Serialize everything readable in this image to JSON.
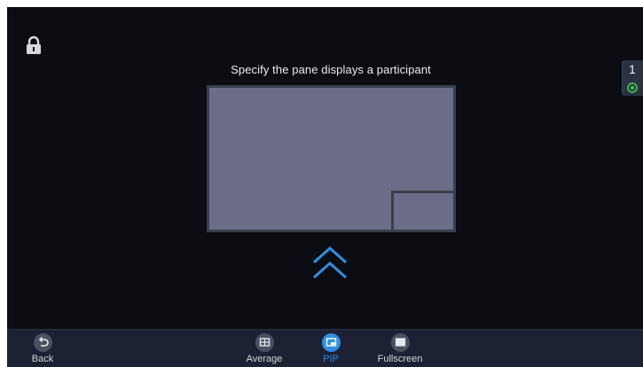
{
  "title": "Specify the pane displays a participant",
  "side_tab": {
    "number": "1"
  },
  "bottom_bar": {
    "back": "Back",
    "average": "Average",
    "pip": "PIP",
    "fullscreen": "Fullscreen",
    "active": "pip"
  },
  "icons": {
    "lock": "lock-icon",
    "chevron": "double-chevron-up-icon",
    "back": "back-arrow-icon",
    "average": "grid-layout-icon",
    "pip": "pip-layout-icon",
    "fullscreen": "fullscreen-layout-icon",
    "status": "status-dot-icon"
  },
  "colors": {
    "accent": "#2f8fe3",
    "pane": "#6b6e86",
    "background": "#0b0d12",
    "status": "#3fbf4f"
  }
}
